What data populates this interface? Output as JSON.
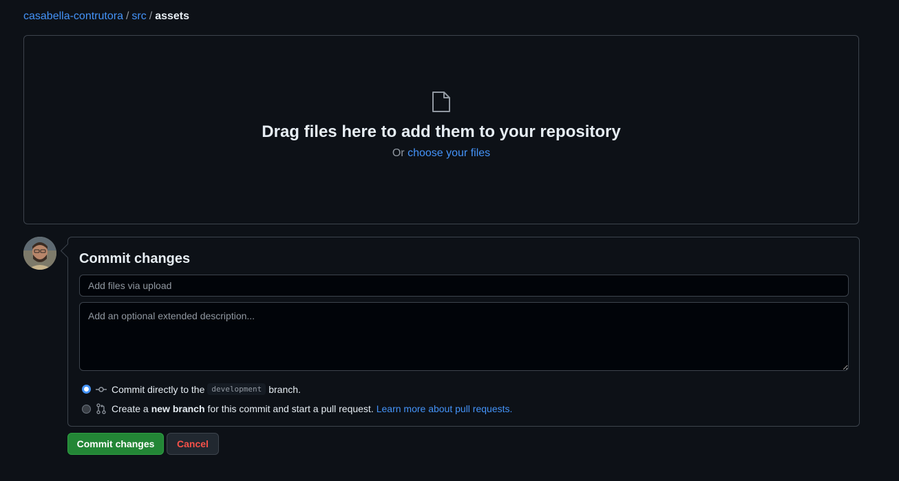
{
  "breadcrumb": {
    "repo": "casabella-contrutora",
    "sep1": "/",
    "folder": "src",
    "sep2": "/",
    "current": "assets"
  },
  "dropzone": {
    "icon": "file-icon",
    "headline": "Drag files here to add them to your repository",
    "or_text": "Or",
    "choose_link": "choose your files"
  },
  "commit": {
    "title": "Commit changes",
    "summary_placeholder": "Add files via upload",
    "description_placeholder": "Add an optional extended description...",
    "option_direct": {
      "prefix": "Commit directly to the",
      "branch": "development",
      "suffix": "branch.",
      "selected": true
    },
    "option_new": {
      "prefix": "Create a",
      "bold": "new branch",
      "suffix": "for this commit and start a pull request.",
      "link": "Learn more about pull requests.",
      "selected": false
    }
  },
  "buttons": {
    "commit": "Commit changes",
    "cancel": "Cancel"
  },
  "colors": {
    "background": "#0d1117",
    "link": "#4493f8",
    "primary_button": "#238636",
    "danger_text": "#f85149"
  }
}
